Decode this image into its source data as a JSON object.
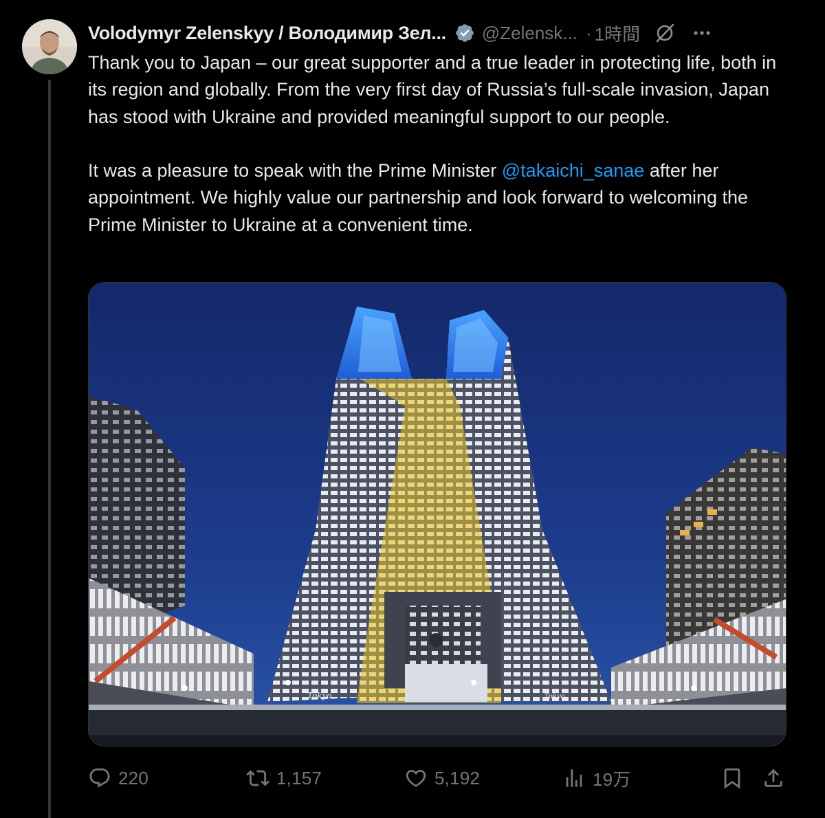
{
  "author": {
    "display_name": "Volodymyr Zelenskyy / Володимир Зел...",
    "handle": "@Zelensk...",
    "separator": "·",
    "time": "1時間",
    "verified_color": "#829aab"
  },
  "tweet": {
    "paragraph1": "Thank you to Japan – our great supporter and a true leader in protecting life, both in its region and globally. From the very first day of Russia’s full-scale invasion, Japan has stood with Ukraine and provided meaningful support to our people.",
    "paragraph2_before": "It was a pleasure to speak with the Prime Minister ",
    "mention": "@takaichi_sanae",
    "paragraph2_after": " after her appointment. We highly value our partnership and look forward to welcoming the Prime Minister to Ukraine at a convenient time."
  },
  "media": {
    "signage_left": "Tokyo",
    "signage_right": "Tokyo"
  },
  "actions": {
    "replies": "220",
    "reposts": "1,157",
    "likes": "5,192",
    "views": "19万"
  },
  "icons": {
    "reply": "reply-icon",
    "repost": "repost-icon",
    "like": "heart-icon",
    "views": "views-icon",
    "bookmark": "bookmark-icon",
    "share": "share-icon",
    "grok": "grok-icon",
    "more": "more-icon"
  },
  "colors": {
    "background": "#000000",
    "text": "#e7e9ea",
    "muted": "#71767b",
    "link": "#1d9bf0",
    "sky": "#1c3a86",
    "building_blue_light": "#2f7dff",
    "building_yellow_light": "#e3c85a"
  }
}
